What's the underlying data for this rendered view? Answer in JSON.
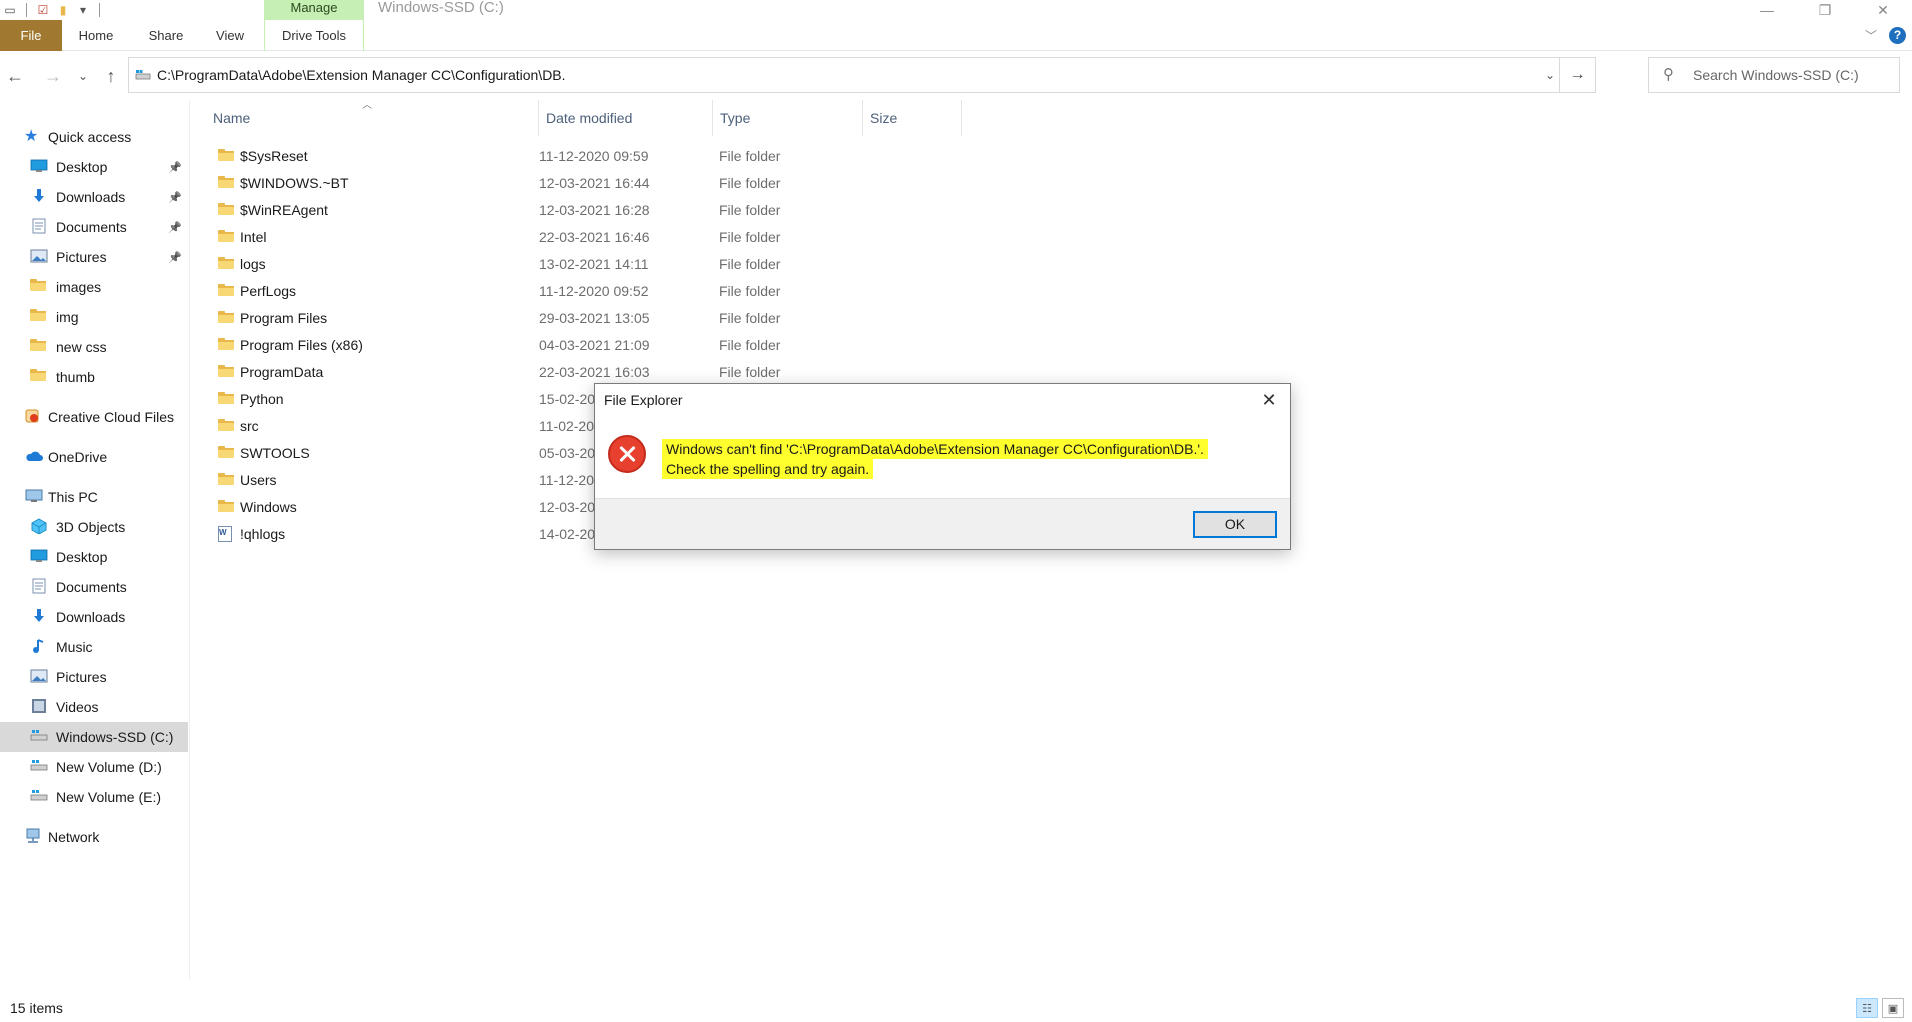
{
  "window": {
    "title": "Windows-SSD (C:)",
    "manage_tab": "Manage"
  },
  "ribbon": {
    "tabs": [
      "File",
      "Home",
      "Share",
      "View",
      "Drive Tools"
    ]
  },
  "address": {
    "path": "C:\\ProgramData\\Adobe\\Extension Manager CC\\Configuration\\DB."
  },
  "search": {
    "placeholder": "Search Windows-SSD (C:)"
  },
  "nav": {
    "quick_access": {
      "label": "Quick access",
      "items": [
        {
          "label": "Desktop",
          "icon": "desktop-icon",
          "pinned": true
        },
        {
          "label": "Downloads",
          "icon": "downloads-icon",
          "pinned": true
        },
        {
          "label": "Documents",
          "icon": "documents-icon",
          "pinned": true
        },
        {
          "label": "Pictures",
          "icon": "pictures-icon",
          "pinned": true
        },
        {
          "label": "images",
          "icon": "folder-icon",
          "pinned": false
        },
        {
          "label": "img",
          "icon": "folder-icon",
          "pinned": false
        },
        {
          "label": "new css",
          "icon": "folder-icon",
          "pinned": false
        },
        {
          "label": "thumb",
          "icon": "folder-icon",
          "pinned": false
        }
      ]
    },
    "creative_cloud": "Creative Cloud Files",
    "onedrive": "OneDrive",
    "this_pc": {
      "label": "This PC",
      "items": [
        {
          "label": "3D Objects",
          "icon": "3d-objects-icon"
        },
        {
          "label": "Desktop",
          "icon": "desktop-icon"
        },
        {
          "label": "Documents",
          "icon": "documents-icon"
        },
        {
          "label": "Downloads",
          "icon": "downloads-icon"
        },
        {
          "label": "Music",
          "icon": "music-icon"
        },
        {
          "label": "Pictures",
          "icon": "pictures-icon"
        },
        {
          "label": "Videos",
          "icon": "videos-icon"
        },
        {
          "label": "Windows-SSD (C:)",
          "icon": "drive-icon",
          "selected": true
        },
        {
          "label": "New Volume (D:)",
          "icon": "drive-icon"
        },
        {
          "label": "New Volume (E:)",
          "icon": "drive-icon"
        }
      ]
    },
    "network": "Network"
  },
  "columns": {
    "name": "Name",
    "date": "Date modified",
    "type": "Type",
    "size": "Size"
  },
  "files": [
    {
      "name": "$SysReset",
      "date": "11-12-2020 09:59",
      "type": "File folder",
      "icon": "folder-icon"
    },
    {
      "name": "$WINDOWS.~BT",
      "date": "12-03-2021 16:44",
      "type": "File folder",
      "icon": "folder-icon"
    },
    {
      "name": "$WinREAgent",
      "date": "12-03-2021 16:28",
      "type": "File folder",
      "icon": "folder-icon"
    },
    {
      "name": "Intel",
      "date": "22-03-2021 16:46",
      "type": "File folder",
      "icon": "folder-icon"
    },
    {
      "name": "logs",
      "date": "13-02-2021 14:11",
      "type": "File folder",
      "icon": "folder-icon"
    },
    {
      "name": "PerfLogs",
      "date": "11-12-2020 09:52",
      "type": "File folder",
      "icon": "folder-icon"
    },
    {
      "name": "Program Files",
      "date": "29-03-2021 13:05",
      "type": "File folder",
      "icon": "folder-icon"
    },
    {
      "name": "Program Files (x86)",
      "date": "04-03-2021 21:09",
      "type": "File folder",
      "icon": "folder-icon"
    },
    {
      "name": "ProgramData",
      "date": "22-03-2021 16:03",
      "type": "File folder",
      "icon": "folder-icon"
    },
    {
      "name": "Python",
      "date": "15-02-20",
      "type": "",
      "icon": "folder-icon"
    },
    {
      "name": "src",
      "date": "11-02-20",
      "type": "",
      "icon": "folder-icon"
    },
    {
      "name": "SWTOOLS",
      "date": "05-03-20",
      "type": "",
      "icon": "folder-icon"
    },
    {
      "name": "Users",
      "date": "11-12-20",
      "type": "",
      "icon": "folder-icon"
    },
    {
      "name": "Windows",
      "date": "12-03-20",
      "type": "",
      "icon": "folder-icon"
    },
    {
      "name": "!qhlogs",
      "date": "14-02-20",
      "type": "",
      "icon": "document-icon"
    }
  ],
  "status": {
    "item_count": "15 items"
  },
  "dialog": {
    "title": "File Explorer",
    "message_line1": "Windows can't find 'C:\\ProgramData\\Adobe\\Extension Manager CC\\Configuration\\DB.'.",
    "message_line2": "Check the spelling and try again.",
    "ok_label": "OK",
    "highlight_color": "#ffff2e"
  },
  "colors": {
    "file_tab": "#a1782f",
    "manage_tab": "#c6efb4",
    "selection": "#cce8ff",
    "accent": "#0078d7",
    "error": "#e8402e"
  }
}
